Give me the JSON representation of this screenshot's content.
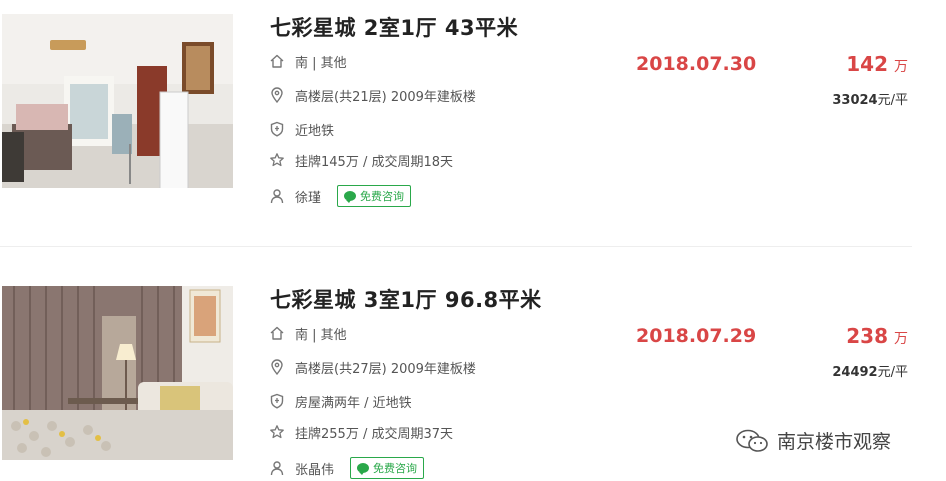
{
  "listings": [
    {
      "title": "七彩星城 2室1厅 43平米",
      "orientation": "南 | 其他",
      "floor": "高楼层(共21层) 2009年建板楼",
      "tag": "近地铁",
      "listing_info": "挂牌145万 / 成交周期18天",
      "agent": "徐瑾",
      "consult": "免费咨询",
      "date": "2018.07.30",
      "price": "142",
      "price_unit": "万",
      "unit_price": "33024",
      "unit_price_suffix": "元/平"
    },
    {
      "title": "七彩星城 3室1厅 96.8平米",
      "orientation": "南 | 其他",
      "floor": "高楼层(共27层) 2009年建板楼",
      "tag": "房屋满两年 / 近地铁",
      "listing_info": "挂牌255万 / 成交周期37天",
      "agent": "张晶伟",
      "consult": "免费咨询",
      "date": "2018.07.29",
      "price": "238",
      "price_unit": "万",
      "unit_price": "24492",
      "unit_price_suffix": "元/平"
    }
  ],
  "watermark": "南京楼市观察",
  "colors": {
    "accent": "#d94646",
    "consult": "#2aa84a",
    "text": "#333333"
  }
}
